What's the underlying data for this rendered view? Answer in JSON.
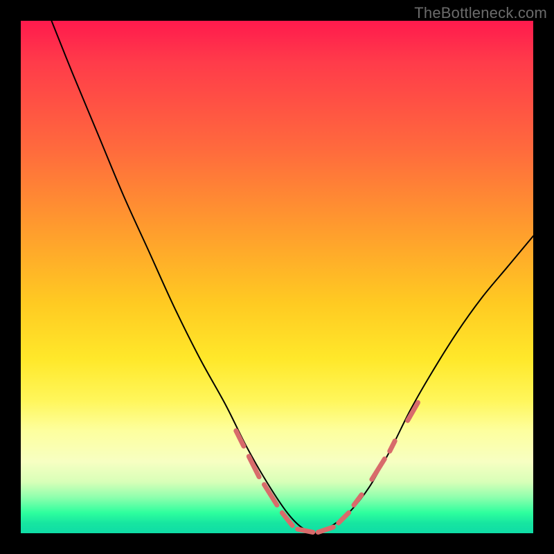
{
  "watermark": "TheBottleneck.com",
  "chart_data": {
    "type": "line",
    "title": "",
    "xlabel": "",
    "ylabel": "",
    "xlim": [
      0,
      100
    ],
    "ylim": [
      0,
      100
    ],
    "grid": false,
    "legend": false,
    "background_gradient": {
      "direction": "vertical",
      "stops": [
        {
          "pos": 0.0,
          "color": "#ff1a4d"
        },
        {
          "pos": 0.25,
          "color": "#ff6a3d"
        },
        {
          "pos": 0.55,
          "color": "#ffca22"
        },
        {
          "pos": 0.8,
          "color": "#fdff9e"
        },
        {
          "pos": 0.93,
          "color": "#8effad"
        },
        {
          "pos": 1.0,
          "color": "#0fdca6"
        }
      ]
    },
    "series": [
      {
        "name": "bottleneck-curve",
        "stroke": "#000000",
        "stroke_width": 2,
        "x": [
          6,
          10,
          15,
          20,
          25,
          30,
          35,
          40,
          44,
          48,
          52,
          55,
          58,
          60,
          64,
          68,
          72,
          76,
          80,
          85,
          90,
          95,
          100
        ],
        "y": [
          100,
          90,
          78,
          66,
          55,
          44,
          34,
          25,
          17,
          10,
          4,
          1,
          0,
          1,
          4,
          9,
          16,
          24,
          31,
          39,
          46,
          52,
          58
        ]
      }
    ],
    "markers": {
      "name": "highlight-dashes",
      "stroke": "#d86b6b",
      "stroke_width": 7,
      "segments": [
        {
          "x0": 42.0,
          "y0": 20.0,
          "x1": 43.5,
          "y1": 17.0
        },
        {
          "x0": 44.5,
          "y0": 15.0,
          "x1": 46.5,
          "y1": 11.0
        },
        {
          "x0": 47.5,
          "y0": 9.5,
          "x1": 50.0,
          "y1": 5.5
        },
        {
          "x0": 51.0,
          "y0": 4.0,
          "x1": 53.0,
          "y1": 1.5
        },
        {
          "x0": 54.0,
          "y0": 0.8,
          "x1": 57.0,
          "y1": 0.2
        },
        {
          "x0": 58.0,
          "y0": 0.2,
          "x1": 61.0,
          "y1": 1.2
        },
        {
          "x0": 62.0,
          "y0": 2.0,
          "x1": 64.0,
          "y1": 4.0
        },
        {
          "x0": 65.0,
          "y0": 5.5,
          "x1": 66.5,
          "y1": 7.5
        },
        {
          "x0": 68.5,
          "y0": 10.5,
          "x1": 71.0,
          "y1": 14.5
        },
        {
          "x0": 72.0,
          "y0": 16.0,
          "x1": 73.0,
          "y1": 18.0
        },
        {
          "x0": 75.5,
          "y0": 22.0,
          "x1": 77.5,
          "y1": 25.5
        }
      ]
    }
  }
}
